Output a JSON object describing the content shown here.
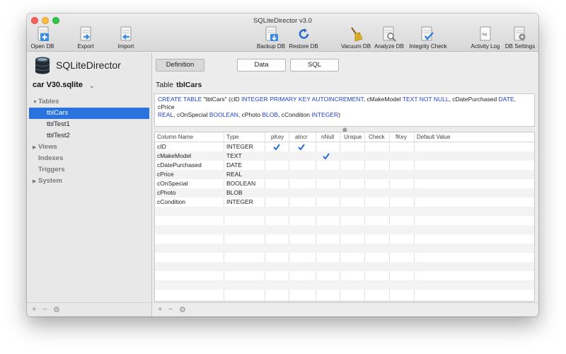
{
  "window": {
    "title": "SQLiteDirector v3.0"
  },
  "toolbar": {
    "open_db": "Open DB",
    "export": "Export",
    "import": "Import",
    "backup_db": "Backup DB",
    "restore_db": "Restore DB",
    "vacuum_db": "Vacuum DB",
    "analyze_db": "Analyze DB",
    "integrity_check": "Integrity Check",
    "activity_log": "Activity Log",
    "db_settings": "DB Settings"
  },
  "sidebar": {
    "app_name": "SQLiteDirector",
    "database": "car V30.sqlite",
    "tables_header": "Tables",
    "tables": [
      "tblCars",
      "tblTest1",
      "tblTest2"
    ],
    "selected_table": "tblCars",
    "views": "Views",
    "indexes": "Indexes",
    "triggers": "Triggers",
    "system": "System",
    "footer": {
      "add": "+",
      "remove": "−",
      "settings": "⚙"
    }
  },
  "tabs": {
    "definition": "Definition",
    "data": "Data",
    "sql": "SQL",
    "active": "Definition"
  },
  "table_heading": {
    "prefix": "Table",
    "name": "tblCars"
  },
  "create_sql": {
    "p1": "CREATE TABLE",
    "p2": " \"tblCars\" (cID ",
    "p3": "INTEGER PRIMARY KEY AUTOINCREMENT",
    "p4": ", cMakeModel ",
    "p5": "TEXT NOT NULL",
    "p6": ", cDatePurchased ",
    "p7": "DATE",
    "p8": ", cPrice",
    "p9": "REAL",
    "p10": ", cOnSpecial ",
    "p11": "BOOLEAN",
    "p12": ", cPhoto ",
    "p13": "BLOB",
    "p14": ", cCondition ",
    "p15": "INTEGER",
    "p16": ")"
  },
  "columns_header": [
    "Column Name",
    "Type",
    "pKey",
    "aIncr",
    "nNull",
    "Unique",
    "Check",
    "fKey",
    "Default Value"
  ],
  "columns": [
    {
      "name": "cID",
      "type": "INTEGER",
      "pkey": true,
      "aincr": true,
      "nnull": false
    },
    {
      "name": "cMakeModel",
      "type": "TEXT",
      "pkey": false,
      "aincr": false,
      "nnull": true
    },
    {
      "name": "cDatePurchased",
      "type": "DATE",
      "pkey": false,
      "aincr": false,
      "nnull": false
    },
    {
      "name": "cPrice",
      "type": "REAL",
      "pkey": false,
      "aincr": false,
      "nnull": false
    },
    {
      "name": "cOnSpecial",
      "type": "BOOLEAN",
      "pkey": false,
      "aincr": false,
      "nnull": false
    },
    {
      "name": "cPhoto",
      "type": "BLOB",
      "pkey": false,
      "aincr": false,
      "nnull": false
    },
    {
      "name": "cCondition",
      "type": "INTEGER",
      "pkey": false,
      "aincr": false,
      "nnull": false
    }
  ],
  "colors": {
    "accent": "#2a72de",
    "keyword": "#1f3fd6",
    "check": "#2a6fd6"
  }
}
